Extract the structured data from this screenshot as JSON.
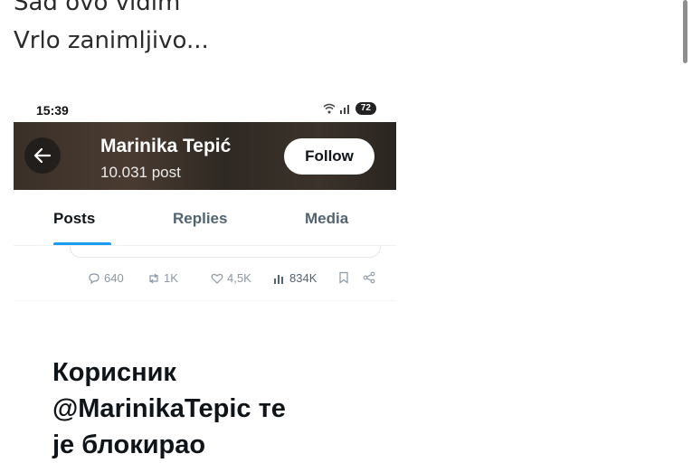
{
  "caption": {
    "line1": "Sad ovo vidim",
    "line2": "Vrlo zanimljivo..."
  },
  "status_bar": {
    "time": "15:39",
    "battery": "72"
  },
  "profile": {
    "name": "Marinika Tepić",
    "post_count": "10.031 post",
    "follow_label": "Follow"
  },
  "tabs": [
    "Posts",
    "Replies",
    "Media"
  ],
  "active_tab": "Posts",
  "post_actions": {
    "replies": "640",
    "reposts": "1K",
    "likes": "4,5K",
    "views": "834K"
  },
  "blocked_message": {
    "line1": "Корисник",
    "line2": "@MarinikaTepic те",
    "line3": "је блокирао"
  },
  "colors": {
    "accent": "#1d9bf0",
    "muted_text": "#536471",
    "banner": "#3a3028"
  },
  "icons": [
    "back-arrow-icon",
    "wifi-icon",
    "signal-icon",
    "battery-icon",
    "reply-icon",
    "retweet-icon",
    "like-icon",
    "views-icon",
    "bookmark-icon",
    "share-icon"
  ]
}
